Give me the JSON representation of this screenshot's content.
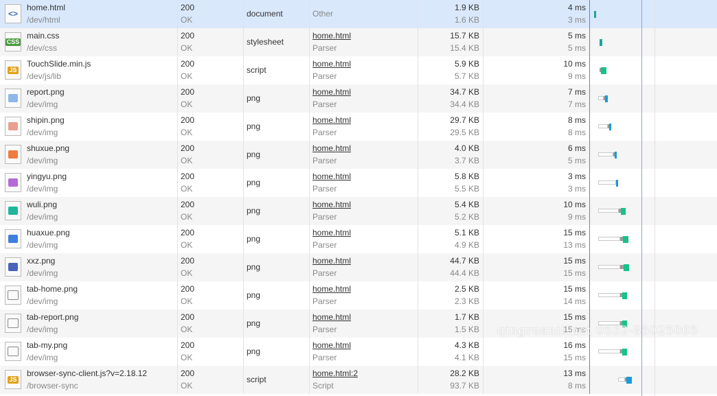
{
  "rows": [
    {
      "name": "home.html",
      "path": "/dev/html",
      "status": "200",
      "status_text": "OK",
      "type": "document",
      "initiator": "Other",
      "initiator_sub": "",
      "size": "1.9 KB",
      "size_sub": "1.6 KB",
      "time": "4 ms",
      "latency": "3 ms",
      "icon": "html-file-icon",
      "badge": "<>",
      "badge_color": "#3f6fb5"
    },
    {
      "name": "main.css",
      "path": "/dev/css",
      "status": "200",
      "status_text": "OK",
      "type": "stylesheet",
      "initiator": "home.html",
      "initiator_sub": "Parser",
      "size": "15.7 KB",
      "size_sub": "15.4 KB",
      "time": "5 ms",
      "latency": "5 ms",
      "icon": "css-file-icon",
      "badge": "CSS",
      "badge_color": "#4a9b3e"
    },
    {
      "name": "TouchSlide.min.js",
      "path": "/dev/js/lib",
      "status": "200",
      "status_text": "OK",
      "type": "script",
      "initiator": "home.html",
      "initiator_sub": "Parser",
      "size": "5.9 KB",
      "size_sub": "5.7 KB",
      "time": "10 ms",
      "latency": "9 ms",
      "icon": "js-file-icon",
      "badge": "JS",
      "badge_color": "#e3a21a"
    },
    {
      "name": "report.png",
      "path": "/dev/img",
      "status": "200",
      "status_text": "OK",
      "type": "png",
      "initiator": "home.html",
      "initiator_sub": "Parser",
      "size": "34.7 KB",
      "size_sub": "34.4 KB",
      "time": "7 ms",
      "latency": "7 ms",
      "icon": "image-thumbnail-icon",
      "badge": "",
      "badge_color": "#8fb8e8"
    },
    {
      "name": "shipin.png",
      "path": "/dev/img",
      "status": "200",
      "status_text": "OK",
      "type": "png",
      "initiator": "home.html",
      "initiator_sub": "Parser",
      "size": "29.7 KB",
      "size_sub": "29.5 KB",
      "time": "8 ms",
      "latency": "8 ms",
      "icon": "image-thumbnail-icon",
      "badge": "",
      "badge_color": "#e8a08f"
    },
    {
      "name": "shuxue.png",
      "path": "/dev/img",
      "status": "200",
      "status_text": "OK",
      "type": "png",
      "initiator": "home.html",
      "initiator_sub": "Parser",
      "size": "4.0 KB",
      "size_sub": "3.7 KB",
      "time": "6 ms",
      "latency": "5 ms",
      "icon": "image-thumbnail-icon",
      "badge": "",
      "badge_color": "#f07b3f"
    },
    {
      "name": "yingyu.png",
      "path": "/dev/img",
      "status": "200",
      "status_text": "OK",
      "type": "png",
      "initiator": "home.html",
      "initiator_sub": "Parser",
      "size": "5.8 KB",
      "size_sub": "5.5 KB",
      "time": "3 ms",
      "latency": "3 ms",
      "icon": "image-thumbnail-icon",
      "badge": "",
      "badge_color": "#b46bd8"
    },
    {
      "name": "wuli.png",
      "path": "/dev/img",
      "status": "200",
      "status_text": "OK",
      "type": "png",
      "initiator": "home.html",
      "initiator_sub": "Parser",
      "size": "5.4 KB",
      "size_sub": "5.2 KB",
      "time": "10 ms",
      "latency": "9 ms",
      "icon": "image-thumbnail-icon",
      "badge": "",
      "badge_color": "#1fb69c"
    },
    {
      "name": "huaxue.png",
      "path": "/dev/img",
      "status": "200",
      "status_text": "OK",
      "type": "png",
      "initiator": "home.html",
      "initiator_sub": "Parser",
      "size": "5.1 KB",
      "size_sub": "4.9 KB",
      "time": "15 ms",
      "latency": "13 ms",
      "icon": "image-thumbnail-icon",
      "badge": "",
      "badge_color": "#3d7fe0"
    },
    {
      "name": "xxz.png",
      "path": "/dev/img",
      "status": "200",
      "status_text": "OK",
      "type": "png",
      "initiator": "home.html",
      "initiator_sub": "Parser",
      "size": "44.7 KB",
      "size_sub": "44.4 KB",
      "time": "15 ms",
      "latency": "15 ms",
      "icon": "image-thumbnail-icon",
      "badge": "",
      "badge_color": "#4a63b8"
    },
    {
      "name": "tab-home.png",
      "path": "/dev/img",
      "status": "200",
      "status_text": "OK",
      "type": "png",
      "initiator": "home.html",
      "initiator_sub": "Parser",
      "size": "2.5 KB",
      "size_sub": "2.3 KB",
      "time": "15 ms",
      "latency": "14 ms",
      "icon": "home-outline-icon",
      "badge": "",
      "badge_color": "#888888"
    },
    {
      "name": "tab-report.png",
      "path": "/dev/img",
      "status": "200",
      "status_text": "OK",
      "type": "png",
      "initiator": "home.html",
      "initiator_sub": "Parser",
      "size": "1.7 KB",
      "size_sub": "1.5 KB",
      "time": "15 ms",
      "latency": "15 ms",
      "icon": "bar-chart-outline-icon",
      "badge": "",
      "badge_color": "#888888"
    },
    {
      "name": "tab-my.png",
      "path": "/dev/img",
      "status": "200",
      "status_text": "OK",
      "type": "png",
      "initiator": "home.html",
      "initiator_sub": "Parser",
      "size": "4.3 KB",
      "size_sub": "4.1 KB",
      "time": "16 ms",
      "latency": "15 ms",
      "icon": "user-outline-icon",
      "badge": "",
      "badge_color": "#888888"
    },
    {
      "name": "browser-sync-client.js?v=2.18.12",
      "path": "/browser-sync",
      "status": "200",
      "status_text": "OK",
      "type": "script",
      "initiator": "home.html:2",
      "initiator_sub": "Script",
      "size": "28.2 KB",
      "size_sub": "93.7 KB",
      "time": "13 ms",
      "latency": "8 ms",
      "icon": "js-file-icon",
      "badge": "JS",
      "badge_color": "#e3a21a"
    }
  ],
  "watermark": "qingruanit.net 0532-85025005"
}
